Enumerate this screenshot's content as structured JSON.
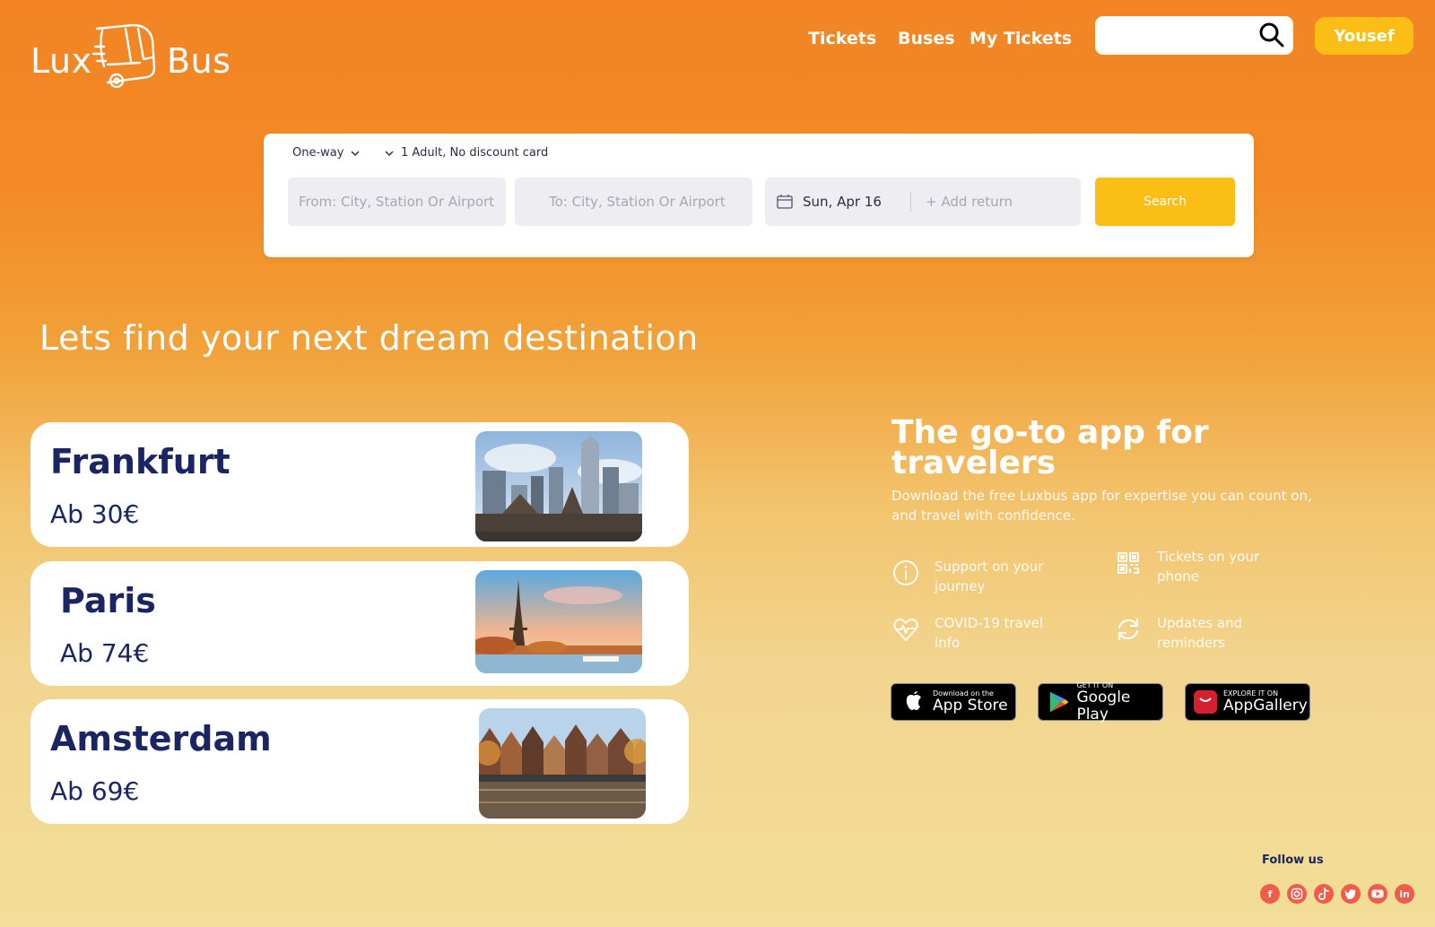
{
  "logo": {
    "left": "Lux",
    "right": "Bus"
  },
  "nav": {
    "tickets": "Tickets",
    "buses": "Buses",
    "my_tickets": "My Tickets",
    "search_placeholder": "",
    "user": "Yousef"
  },
  "booking": {
    "trip_type": "One-way",
    "passengers": "1 Adult, No discount card",
    "from_placeholder": "From: City, Station Or Airport",
    "to_placeholder": "To: City, Station Or Airport",
    "date": "Sun, Apr 16",
    "add_return": "+ Add return",
    "search_label": "Search"
  },
  "headline": "Lets find your next dream destination",
  "destinations": [
    {
      "city": "Frankfurt",
      "price": "Ab 30€"
    },
    {
      "city": "Paris",
      "price": "Ab 74€"
    },
    {
      "city": "Amsterdam",
      "price": "Ab 69€"
    }
  ],
  "promo": {
    "title": "The go-to app for travelers",
    "subtitle": "Download the free Luxbus  app for expertise you can count on, and travel with confidence.",
    "features": [
      {
        "icon": "info-icon",
        "label": "Support on your journey"
      },
      {
        "icon": "qr-code-icon",
        "label": "Tickets on your phone"
      },
      {
        "icon": "heart-pulse-icon",
        "label": "COVID-19 travel info"
      },
      {
        "icon": "refresh-icon",
        "label": "Updates and reminders"
      }
    ],
    "stores": [
      {
        "small": "Download on the",
        "big": "App Store"
      },
      {
        "small": "GET IT ON",
        "big": "Google Play"
      },
      {
        "small": "EXPLORE IT ON",
        "big": "AppGallery"
      }
    ]
  },
  "follow": {
    "label": "Follow us",
    "networks": [
      "f",
      "ig",
      "tt",
      "tw",
      "yt",
      "in"
    ]
  },
  "colors": {
    "accent": "#fbbe16",
    "navy": "#1b2563",
    "orange": "#f28424",
    "social": "#f25a4a"
  }
}
